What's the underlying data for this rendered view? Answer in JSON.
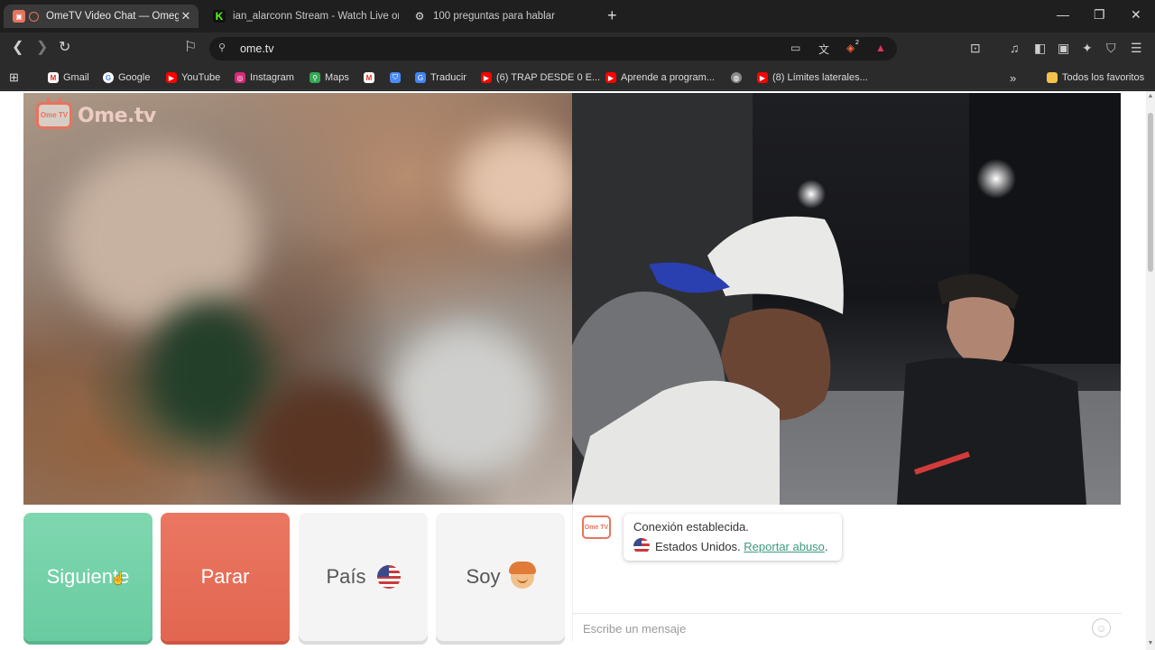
{
  "browser": {
    "tabs": [
      {
        "title": "OmeTV Video Chat — Omegl",
        "active": true
      },
      {
        "title": "ian_alarconn Stream - Watch Live on",
        "active": false
      },
      {
        "title": "100 preguntas para hablar",
        "active": false
      }
    ],
    "new_tab": "+",
    "window_controls": {
      "minimize": "—",
      "restore": "❐",
      "close": "✕"
    },
    "url": "ome.tv",
    "brave_badge": "2",
    "bookmarks": [
      {
        "label": "Gmail",
        "icon": "gmail-icon"
      },
      {
        "label": "Google",
        "icon": "google-icon"
      },
      {
        "label": "YouTube",
        "icon": "youtube-icon"
      },
      {
        "label": "Instagram",
        "icon": "instagram-icon"
      },
      {
        "label": "Maps",
        "icon": "maps-icon"
      },
      {
        "label": "",
        "icon": "gmail-icon"
      },
      {
        "label": "",
        "icon": "shield-icon"
      },
      {
        "label": "Traducir",
        "icon": "translate-icon"
      },
      {
        "label": "(6) TRAP DESDE 0 E...",
        "icon": "youtube-icon"
      },
      {
        "label": "Aprende a program...",
        "icon": "youtube-icon"
      },
      {
        "label": "",
        "icon": "globe-icon"
      },
      {
        "label": "(8) Límites laterales...",
        "icon": "youtube-icon"
      }
    ],
    "bookmarks_overflow": "»",
    "all_bookmarks": "Todos los favoritos"
  },
  "site": {
    "logo_small": "Ome TV",
    "logo_text": "Ome.tv"
  },
  "controls": {
    "next": "Siguiente",
    "stop": "Parar",
    "country": "País",
    "gender": "Soy"
  },
  "chat": {
    "status": "Conexión establecida.",
    "country": "Estados Unidos.",
    "report": "Reportar abuso",
    "report_suffix": ".",
    "placeholder": "Escribe un mensaje"
  },
  "colors": {
    "next_button": "#6fd0a6",
    "stop_button": "#e46d57",
    "link": "#3c9b7a",
    "brand": "#e8735d"
  }
}
